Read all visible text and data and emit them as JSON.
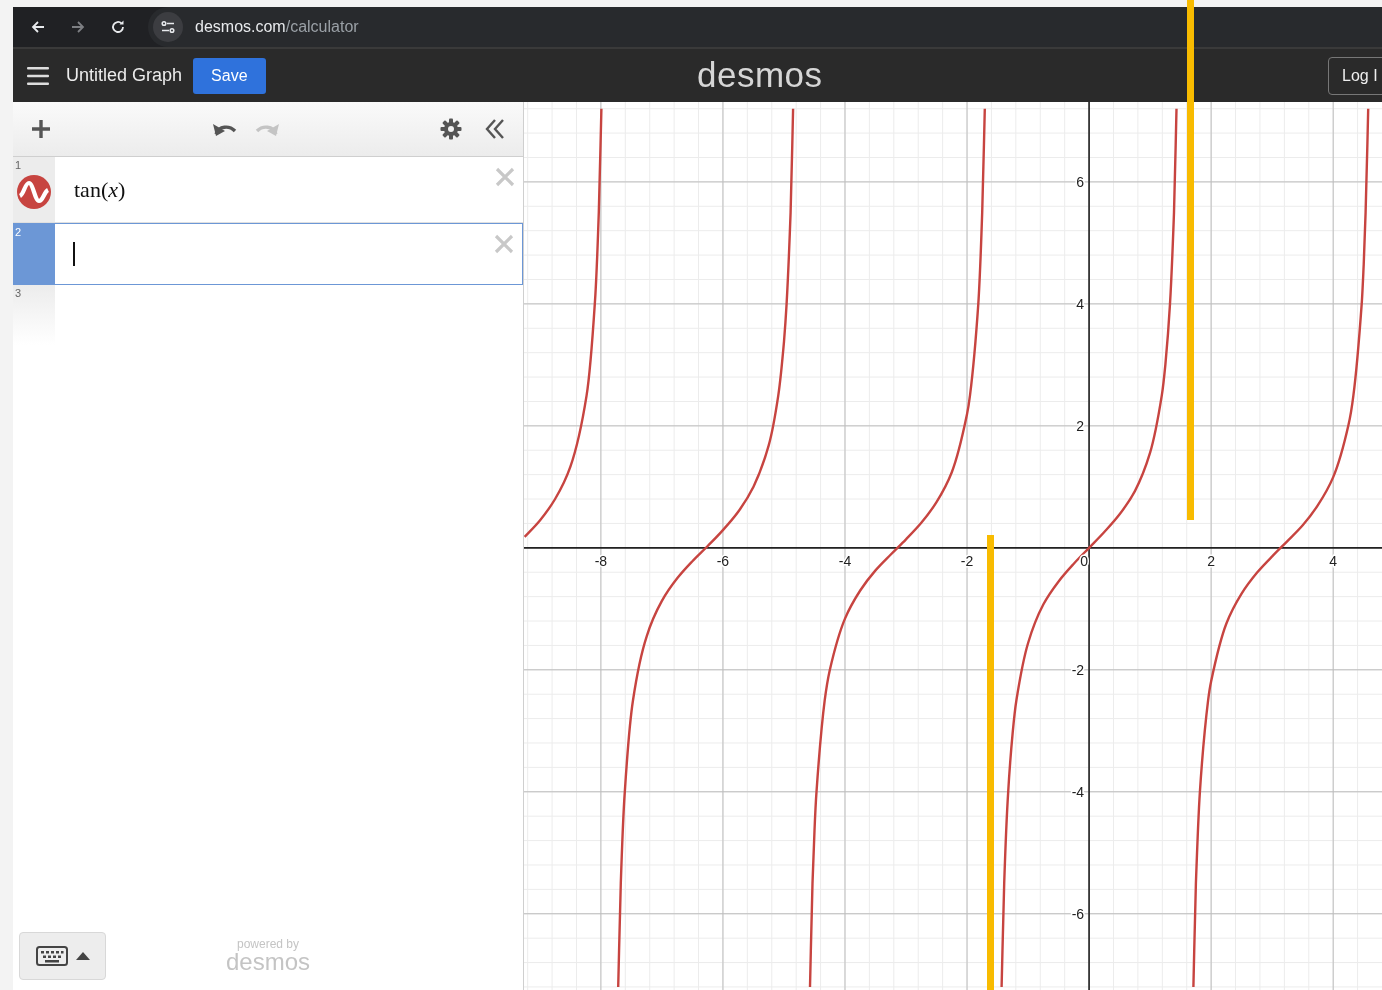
{
  "browser": {
    "back_disabled": false,
    "forward_disabled": true,
    "address": {
      "host": "desmos.com",
      "path": "/calculator"
    }
  },
  "header": {
    "title": "Untitled Graph",
    "save": "Save",
    "logo": "desmos",
    "login": "Log I"
  },
  "toolbar": {
    "undo_disabled": false,
    "redo_disabled": true
  },
  "expressions": [
    {
      "kind": "graph",
      "number": "1",
      "latex": "tan(*x*)",
      "color": "#c74440",
      "selected": false
    },
    {
      "kind": "input",
      "number": "2",
      "selected": true
    },
    {
      "kind": "blank",
      "number": "3",
      "selected": false
    }
  ],
  "footer": {
    "powered_by": "powered by",
    "brand": "desmos"
  },
  "graph": {
    "chart_data": {
      "type": "line",
      "x": [
        -9.25,
        -9,
        -8.75,
        -8.5,
        -8.234,
        -8.099,
        -8.034,
        -7.992,
        -7.716,
        -7.674,
        -7.609,
        -7.474,
        -7.25,
        -7,
        -6.75,
        -6.5,
        -6.25,
        -6,
        -5.75,
        -5.5,
        -5.25,
        -5.093,
        -5,
        -4.957,
        -4.892,
        -4.85,
        -4.574,
        -4.532,
        -4.5,
        -4.467,
        -4.332,
        -4.25,
        -4,
        -3.75,
        -3.5,
        -3.25,
        -3,
        -2.75,
        -2.5,
        -2.25,
        -2,
        -1.951,
        -1.816,
        -1.751,
        -1.709,
        -1.433,
        -1.391,
        -1.326,
        -1.25,
        -1.191,
        -1,
        -0.75,
        -0.5,
        -0.25,
        0,
        0.25,
        0.5,
        0.75,
        1,
        1.191,
        1.25,
        1.326,
        1.391,
        1.433,
        1.709,
        1.751,
        1.816,
        1.951,
        2,
        2.25,
        2.5,
        2.75,
        3,
        3.25,
        3.5,
        3.75,
        4,
        4.25,
        4.332,
        4.467,
        4.5,
        4.532,
        4.574
      ],
      "series": [
        {
          "color": "#c74440",
          "values": [
            0.18,
            0.45,
            0.8,
            1.33,
            2.5,
            4,
            5.5,
            7.2,
            -7.2,
            -5.5,
            -4,
            -2.5,
            -1.45,
            -0.87,
            -0.5,
            -0.22,
            0.03,
            0.29,
            0.59,
            1.0,
            1.68,
            2.5,
            3.38,
            4,
            5.5,
            7.2,
            -7.2,
            -5.5,
            -4.64,
            -4,
            -2.5,
            -2.01,
            -1.16,
            -0.7,
            -0.37,
            -0.11,
            0.14,
            0.41,
            0.75,
            1.24,
            2.19,
            2.5,
            4,
            5.5,
            7.2,
            -7.2,
            -5.5,
            -4,
            -3.01,
            -2.5,
            -1.56,
            -0.93,
            -0.55,
            -0.26,
            0,
            0.26,
            0.55,
            0.93,
            1.56,
            2.5,
            3.01,
            4,
            5.5,
            7.2,
            -7.2,
            -5.5,
            -4,
            -2.5,
            -2.19,
            -1.24,
            -0.75,
            -0.41,
            -0.14,
            0.11,
            0.37,
            0.7,
            1.16,
            2.01,
            2.5,
            4,
            4.64,
            5.5,
            7.2
          ]
        }
      ],
      "xlim": [
        -9.26,
        4.8
      ],
      "ylim": [
        -7.25,
        7.31
      ],
      "xticks": [
        -8,
        -6,
        -4,
        -2,
        0,
        2,
        4
      ],
      "yticks": [
        -6,
        -4,
        -2,
        2,
        4,
        6
      ],
      "grid": true
    }
  }
}
